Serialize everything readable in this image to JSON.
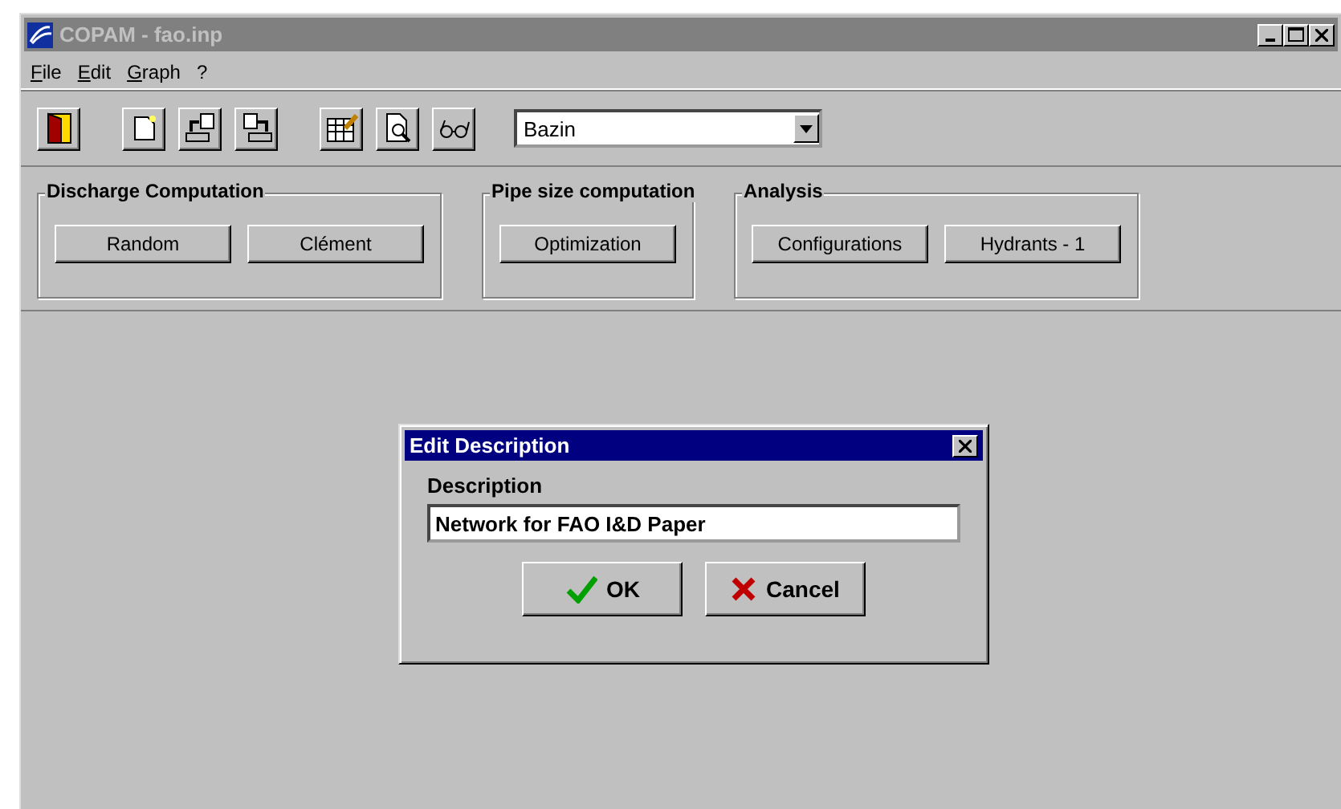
{
  "window": {
    "title": "COPAM - fao.inp",
    "active": false
  },
  "menu": [
    "File",
    "Edit",
    "Graph",
    "?"
  ],
  "toolbar": {
    "buttons": [
      {
        "kind": "exit"
      },
      {
        "kind": "new"
      },
      {
        "kind": "import"
      },
      {
        "kind": "export"
      },
      {
        "kind": "table"
      },
      {
        "kind": "preview"
      },
      {
        "kind": "glasses"
      }
    ],
    "formula": "Bazin"
  },
  "groups": [
    {
      "title": "Discharge Computation",
      "buttons": [
        "Random",
        "Clément"
      ]
    },
    {
      "title": "Pipe size computation",
      "buttons": [
        "Optimization"
      ]
    },
    {
      "title": "Analysis",
      "buttons": [
        "Configurations",
        "Hydrants - 1"
      ]
    }
  ],
  "dialog": {
    "title": "Edit Description",
    "label": "Description",
    "value": "Network for FAO I&D Paper",
    "buttons": [
      {
        "kind": "ok",
        "label": "OK"
      },
      {
        "kind": "cancel",
        "label": "Cancel"
      }
    ]
  }
}
